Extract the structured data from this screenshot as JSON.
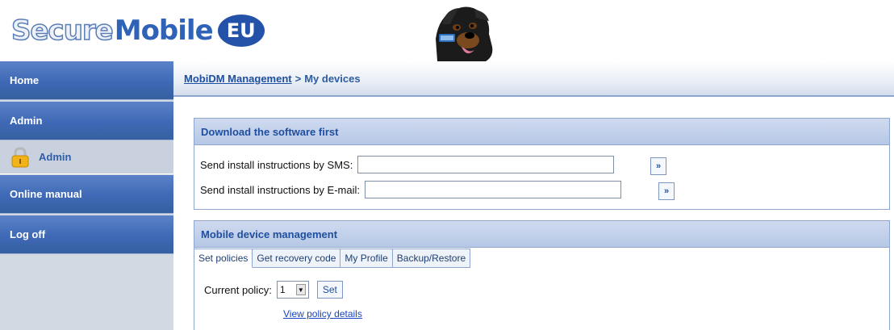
{
  "header": {
    "logo_secure": "Secure",
    "logo_mobile": "Mobile",
    "logo_eu": "EU"
  },
  "sidebar": {
    "items": [
      {
        "label": "Home"
      },
      {
        "label": "Admin"
      },
      {
        "label": "Admin",
        "icon": "lock-icon"
      },
      {
        "label": "Online manual"
      },
      {
        "label": "Log off"
      }
    ]
  },
  "breadcrumb": {
    "link": "MobiDM Management",
    "separator": ">",
    "current": "My devices"
  },
  "download_panel": {
    "title": "Download the software first",
    "sms_label": "Send install instructions by SMS:",
    "sms_value": "",
    "email_label": "Send install instructions by E-mail:",
    "email_value": "",
    "go_label": "»"
  },
  "mdm_panel": {
    "title": "Mobile device management",
    "tabs": [
      {
        "label": "Set policies"
      },
      {
        "label": "Get recovery code"
      },
      {
        "label": "My Profile"
      },
      {
        "label": "Backup/Restore"
      }
    ],
    "policy_label": "Current policy:",
    "policy_value": "1",
    "set_label": "Set",
    "details_link": "View policy details"
  },
  "colors": {
    "nav_blue": "#3f69b6",
    "panel_header": "#b6c8e6",
    "link": "#1f4fa0"
  }
}
